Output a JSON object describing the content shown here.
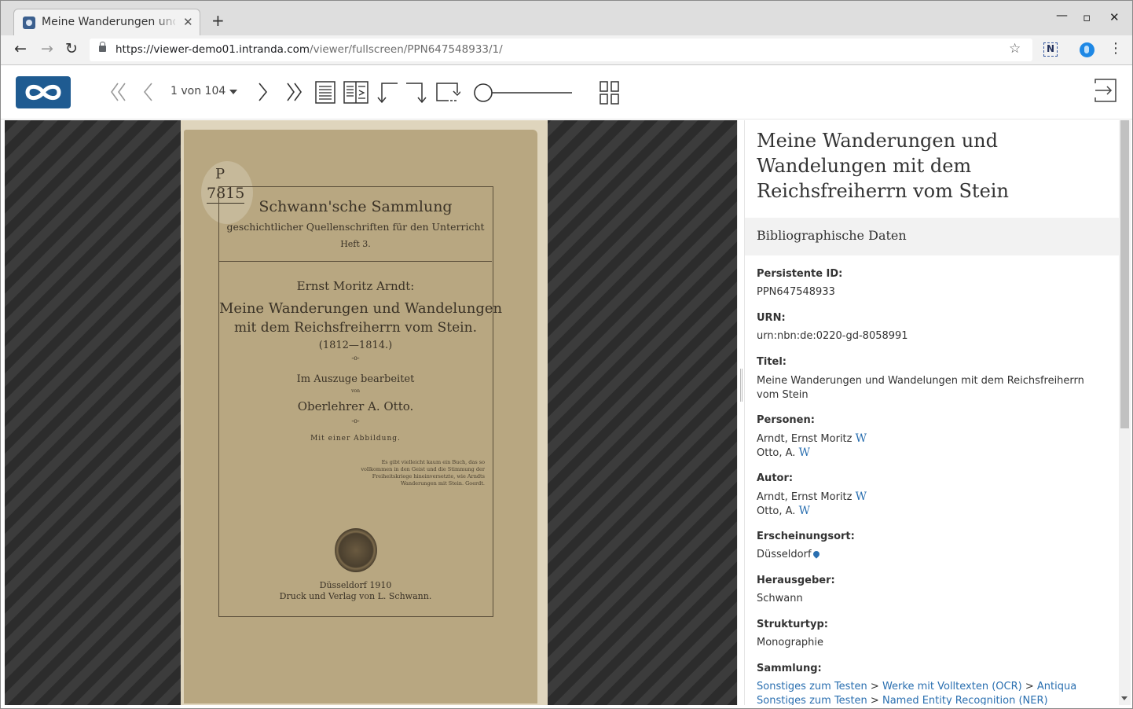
{
  "browser": {
    "tab_title": "Meine Wanderungen und W",
    "url_host": "https://viewer-demo01.intranda.com",
    "url_path": "/viewer/fullscreen/PPN647548933/1/",
    "window_controls": [
      "minimize-icon",
      "maximize-icon",
      "close-icon"
    ]
  },
  "viewer": {
    "page_selector": "1 von 104",
    "icons": [
      "double-chevron-left-icon",
      "chevron-left-icon",
      "chevron-right-icon",
      "double-chevron-right-icon",
      "single-page-view-icon",
      "double-page-view-icon",
      "rotate-left-icon",
      "rotate-right-icon",
      "reset-rotation-icon",
      "zoom-slider",
      "thumbnail-grid-icon",
      "exit-fullscreen-icon"
    ],
    "zoom_level": 0
  },
  "scan": {
    "shelfmark_p": "P",
    "shelfmark_num": "7815",
    "series_title": "Schwann'sche Sammlung",
    "series_subtitle": "geschichtlicher Quellenschriften für den Unterricht",
    "series_issue": "Heft 3.",
    "author": "Ernst Moritz Arndt:",
    "title_line1": "Meine Wanderungen und Wandelungen",
    "title_line2": "mit dem Reichsfreiherrn vom Stein.",
    "years": "(1812—1814.)",
    "ornament1": "-o-",
    "edited": "Im Auszuge bearbeitet",
    "von": "von",
    "editor": "Oberlehrer A. Otto.",
    "ornament2": "-o-",
    "illustration": "Mit einer Abbildung.",
    "quote": "Es gibt vielleicht kaum ein Buch, das so vollkommen in den Geist und die Stimmung der Freiheitskriege hineinversetzte, wie Arndts Wanderungen mit Stein. Goerdt.",
    "place_year": "Düsseldorf 1910",
    "publisher": "Druck und Verlag von L. Schwann."
  },
  "sidebar": {
    "title": "Meine Wanderungen und Wandelungen mit dem Reichsfreiherrn vom Stein",
    "widget_heading": "Bibliographische Daten",
    "persistent_id_label": "Persistente ID:",
    "persistent_id": "PPN647548933",
    "urn_label": "URN:",
    "urn": "urn:nbn:de:0220-gd-8058991",
    "title_label": "Titel:",
    "title_value": "Meine Wanderungen und Wandelungen mit dem Reichsfreiherrn vom Stein",
    "persons_label": "Personen:",
    "persons": [
      "Arndt, Ernst Moritz",
      "Otto, A."
    ],
    "author_label": "Autor:",
    "authors": [
      "Arndt, Ernst Moritz",
      "Otto, A."
    ],
    "wiki_glyph": "W",
    "place_label": "Erscheinungsort:",
    "place": "Düsseldorf",
    "publisher_label": "Herausgeber:",
    "publisher": "Schwann",
    "structure_label": "Strukturtyp:",
    "structure": "Monographie",
    "collection_label": "Sammlung:",
    "collection_row1": [
      "Sonstiges zum Testen",
      "Werke mit Volltexten (OCR)",
      "Antiqua"
    ],
    "collection_row2": [
      "Sonstiges zum Testen",
      "Named Entity Recognition (NER)"
    ],
    "collection_separator": ">"
  },
  "colors": {
    "accent": "#1f5b91",
    "link": "#2a6fb0"
  }
}
